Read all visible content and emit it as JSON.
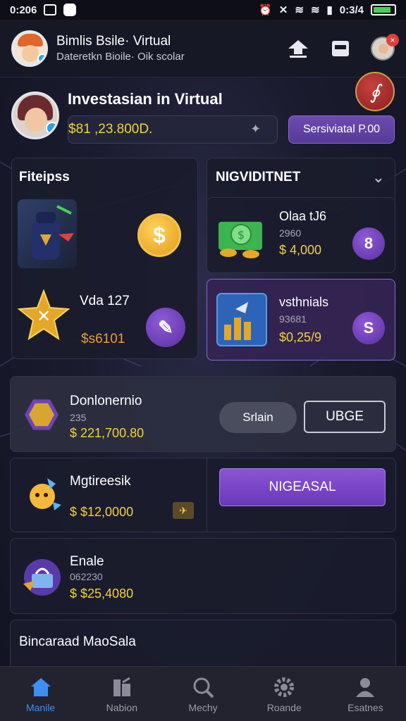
{
  "status_bar": {
    "time_left": "0:206",
    "time_right": "0:3/4"
  },
  "header": {
    "title": "Bimlis Bsile· Virtual",
    "subtitle": "Dateretkn Bioile· Oik scolar",
    "notification_count": "×"
  },
  "profile": {
    "title": "Investasian in Virtual",
    "balance": "$81 ,23.800D.",
    "button_label": "Sersiviatal P.00",
    "fab_symbol": "∮"
  },
  "left_panel": {
    "title": "Fiteipss",
    "coin_symbol": "$",
    "item_name": "Vda 127",
    "item_value": "$s6101"
  },
  "right_panel": {
    "title": "NIGVIDITNET",
    "items": [
      {
        "name": "Olaa tJ6",
        "sub": "2960",
        "value": "$ 4,000",
        "badge": "8"
      },
      {
        "name": "vsthnials",
        "sub": "93681",
        "value": "$0,25/9",
        "badge": "S"
      }
    ]
  },
  "list": {
    "row1": {
      "name": "Donlonernio",
      "sub": "235",
      "value": "$ 221,700.80",
      "btn_secondary": "Srlain",
      "btn_outline": "UBGE"
    },
    "row2": {
      "name": "Mgtireesik",
      "value": "$ $12,0000",
      "action_label": "NIGEASAL"
    },
    "row3": {
      "name": "Enale",
      "sub": "062230",
      "value": "$ $25,4080"
    },
    "row4": {
      "name": "Bincaraad MaoSala"
    }
  },
  "bottom_nav": [
    {
      "label": "Manile",
      "icon": "home-icon",
      "active": true
    },
    {
      "label": "Nabion",
      "icon": "portfolio-icon",
      "active": false
    },
    {
      "label": "Mechy",
      "icon": "search-icon",
      "active": false
    },
    {
      "label": "Roande",
      "icon": "gear-icon",
      "active": false
    },
    {
      "label": "Esatnes",
      "icon": "profile-icon",
      "active": false
    }
  ],
  "colors": {
    "accent_purple": "#6c4bb0",
    "gold": "#f2d23a",
    "active_blue": "#3d8ff0",
    "background": "#1a1b2e"
  }
}
